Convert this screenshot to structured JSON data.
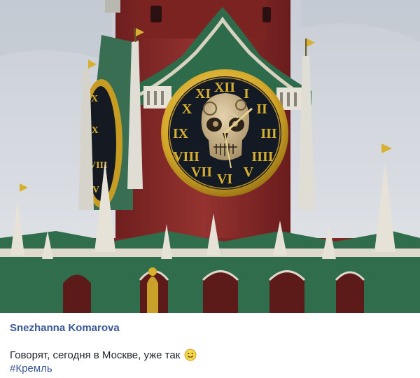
{
  "post": {
    "author": "Snezhanna Komarova",
    "text": "Говорят, сегодня в Москве, уже так",
    "emoji": "smiley-emoji",
    "hashtag": "#Кремль"
  },
  "photo": {
    "subject": "kremlin-spasskaya-tower-clock-with-skull",
    "colors": {
      "sky": "#d6dbe1",
      "brick": "#8e2a28",
      "roof_green": "#2e6b4a",
      "gold": "#d8b030",
      "clock_face": "#141a24",
      "skull": "#cdb894"
    }
  }
}
